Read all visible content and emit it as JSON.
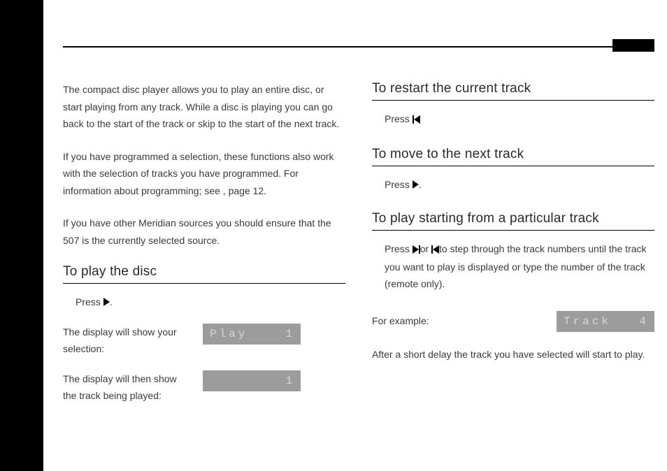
{
  "left": {
    "p1": "The compact disc player allows you to play an entire disc, or start playing from any track. While a disc is playing you can go back to the start of the track or skip to the start of the next track.",
    "p2a": "If you have programmed a selection, these functions also work with the selection of tracks you have programmed. For information about programming; see ",
    "p2b": ", page 12.",
    "p3": "If you have other Meridian sources you should ensure that the 507 is the currently selected source.",
    "h1": "To play the disc",
    "press": "Press ",
    "period": ".",
    "disp_intro": "The display will show your selection:",
    "lcd1_left": "Play",
    "lcd1_right": "1",
    "disp_then": "The display will then show the track being played:",
    "lcd2_right": "1"
  },
  "right": {
    "h1": "To restart the current track",
    "press": "Press ",
    "h2": "To move to the next track",
    "period": ".",
    "h3": "To play starting from a particular track",
    "step_a": "Press ",
    "step_or": "or ",
    "step_b": "to step through the track numbers until the track you want to play is displayed or type the number of the track (remote only).",
    "example_label": "For example:",
    "lcd_left": "Track",
    "lcd_right": "4",
    "after": "After a short delay the track you have selected will start to play."
  }
}
